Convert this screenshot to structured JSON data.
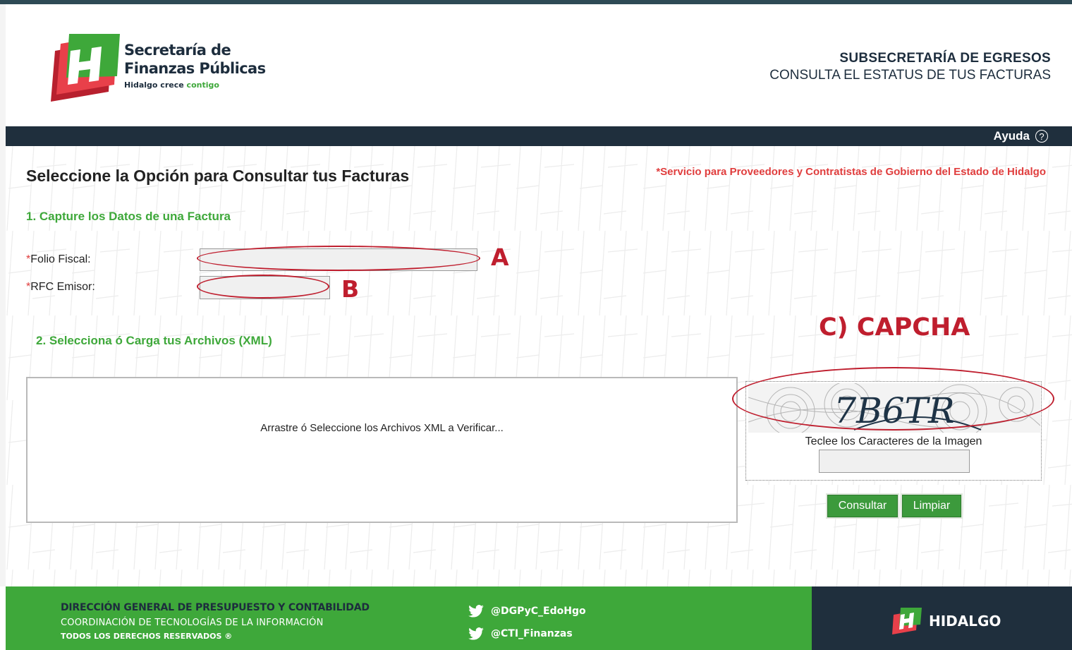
{
  "header": {
    "org_name_line1": "Secretaría de",
    "org_name_line2": "Finanzas Públicas",
    "org_tagline": "Hidalgo crece",
    "org_tagline_accent": "contigo",
    "subsecretaria": "SUBSECRETARÍA DE EGRESOS",
    "subtitle": "CONSULTA EL ESTATUS DE TUS FACTURAS"
  },
  "nav": {
    "help_label": "Ayuda",
    "help_icon": "question-circle-icon"
  },
  "main": {
    "title": "Seleccione la Opción para Consultar tus Facturas",
    "service_note": "*Servicio para Proveedores y Contratistas de Gobierno del Estado de Hidalgo",
    "step1_title": "1. Capture los Datos de una Factura",
    "folio_label_req": "*",
    "folio_label": "Folio Fiscal:",
    "folio_value": "",
    "rfc_label_req": "*",
    "rfc_label": "RFC Emisor:",
    "rfc_value": "",
    "step2_title": "2. Selecciona ó Carga tus Archivos (XML)",
    "dropzone_text": "Arrastre ó Seleccione los Archivos XML a Verificar...",
    "captcha_text": "7B6TR",
    "captcha_caption": "Teclee los Caracteres de la Imagen",
    "captcha_value": "",
    "consultar_label": "Consultar",
    "limpiar_label": "Limpiar"
  },
  "annotations": {
    "a": "A",
    "b": "B",
    "c": "C) CAPCHA"
  },
  "footer": {
    "line1": "DIRECCIÓN GENERAL DE PRESUPUESTO Y CONTABILIDAD",
    "line2": "COORDINACIÓN DE TECNOLOGÍAS DE LA INFORMACIÓN",
    "line3": "TODOS LOS DERECHOS RESERVADOS ®",
    "twitter1": "@DGPyC_EdoHgo",
    "twitter2": "@CTI_Finanzas",
    "brand": "HIDALGO"
  },
  "colors": {
    "green": "#3ea83a",
    "navy": "#1f2f3d",
    "red_note": "#e03d3d",
    "annotation_red": "#bf1e2e"
  }
}
